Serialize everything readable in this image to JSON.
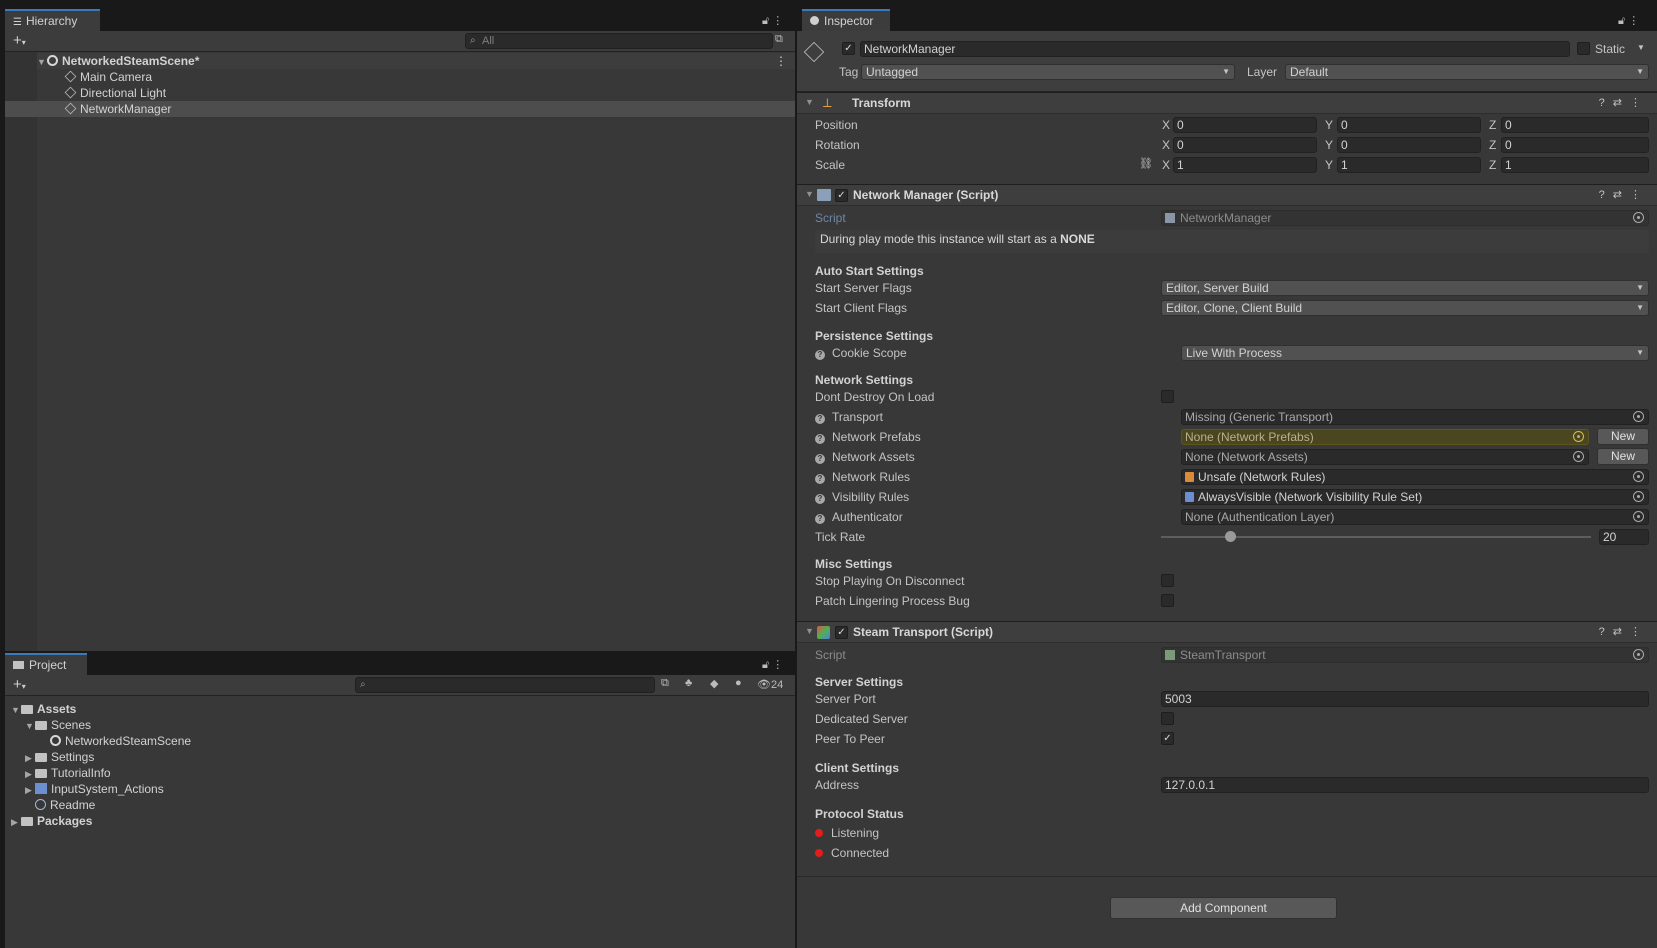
{
  "hierarchy": {
    "tab": "Hierarchy",
    "search_placeholder": "All",
    "scene_name": "NetworkedSteamScene*",
    "items": [
      "Main Camera",
      "Directional Light",
      "NetworkManager"
    ]
  },
  "project": {
    "tab": "Project",
    "hidden_count": "24",
    "tree": {
      "assets": "Assets",
      "scenes": "Scenes",
      "scene_file": "NetworkedSteamScene",
      "settings": "Settings",
      "tutorialinfo": "TutorialInfo",
      "inputsystem": "InputSystem_Actions",
      "readme": "Readme",
      "packages": "Packages"
    }
  },
  "inspector": {
    "tab": "Inspector",
    "object_name": "NetworkManager",
    "static_label": "Static",
    "tag_label": "Tag",
    "tag_value": "Untagged",
    "layer_label": "Layer",
    "layer_value": "Default",
    "transform": {
      "title": "Transform",
      "position_label": "Position",
      "rotation_label": "Rotation",
      "scale_label": "Scale",
      "axes": [
        "X",
        "Y",
        "Z"
      ],
      "position": [
        "0",
        "0",
        "0"
      ],
      "rotation": [
        "0",
        "0",
        "0"
      ],
      "scale": [
        "1",
        "1",
        "1"
      ]
    },
    "network_manager": {
      "title": "Network Manager (Script)",
      "script_label": "Script",
      "script_value": "NetworkManager",
      "info_prefix": "During play mode this instance will start as a ",
      "info_mode": "NONE",
      "auto_start_header": "Auto Start Settings",
      "start_server_label": "Start Server Flags",
      "start_server_value": "Editor, Server Build",
      "start_client_label": "Start Client Flags",
      "start_client_value": "Editor, Clone, Client Build",
      "persistence_header": "Persistence Settings",
      "cookie_label": "Cookie Scope",
      "cookie_value": "Live With Process",
      "network_header": "Network Settings",
      "dont_destroy_label": "Dont Destroy On Load",
      "transport_label": "Transport",
      "transport_value": "Missing (Generic Transport)",
      "prefabs_label": "Network Prefabs",
      "prefabs_value": "None (Network Prefabs)",
      "assets_label": "Network Assets",
      "assets_value": "None (Network Assets)",
      "rules_label": "Network Rules",
      "rules_value": "Unsafe (Network Rules)",
      "visibility_label": "Visibility Rules",
      "visibility_value": "AlwaysVisible (Network Visibility Rule Set)",
      "auth_label": "Authenticator",
      "auth_value": "None (Authentication Layer)",
      "new_label": "New",
      "tick_label": "Tick Rate",
      "tick_value": "20",
      "tick_fraction": 0.16,
      "misc_header": "Misc Settings",
      "stop_playing_label": "Stop Playing On Disconnect",
      "patch_label": "Patch Lingering Process Bug"
    },
    "steam_transport": {
      "title": "Steam Transport (Script)",
      "script_label": "Script",
      "script_value": "SteamTransport",
      "server_header": "Server Settings",
      "port_label": "Server Port",
      "port_value": "5003",
      "dedicated_label": "Dedicated Server",
      "p2p_label": "Peer To Peer",
      "client_header": "Client Settings",
      "address_label": "Address",
      "address_value": "127.0.0.1",
      "protocol_header": "Protocol Status",
      "listening_label": "Listening",
      "connected_label": "Connected"
    },
    "add_component": "Add Component"
  },
  "colors": {
    "accent": "#3a79bb",
    "status_red": "#e31c1c",
    "highlight_field": "#4a4620"
  }
}
